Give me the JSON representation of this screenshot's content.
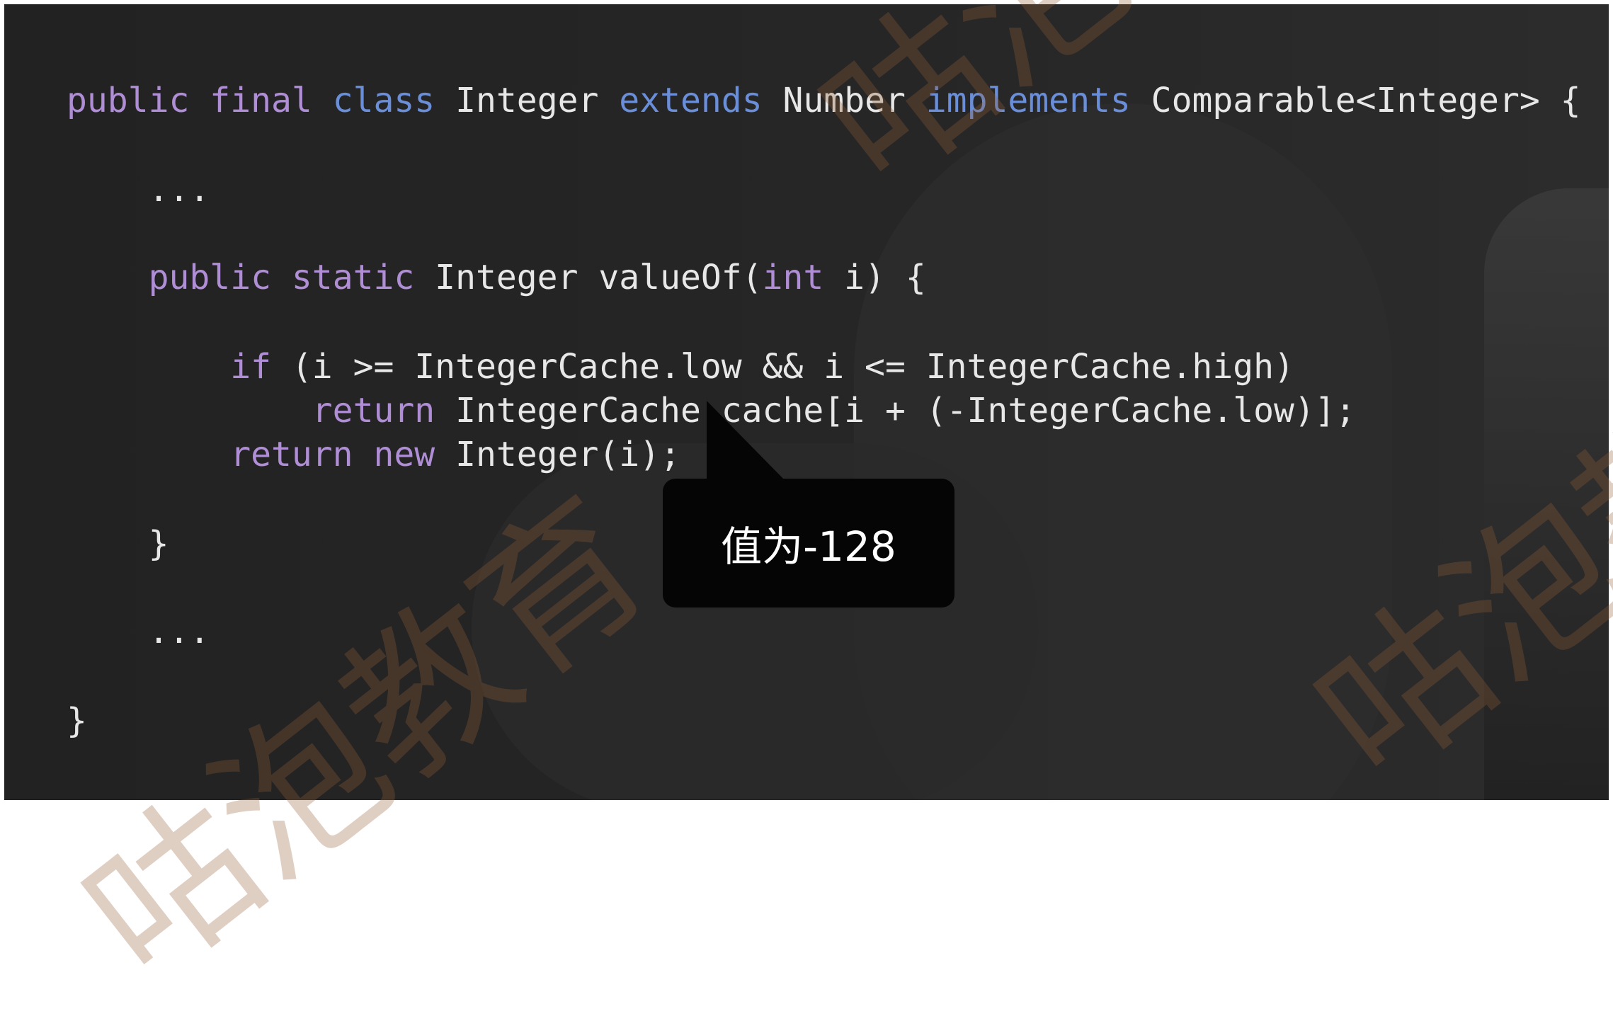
{
  "code": {
    "lines": [
      {
        "tokens": [
          {
            "t": "public",
            "c": "kw"
          },
          {
            "t": " ",
            "c": "plain"
          },
          {
            "t": "final",
            "c": "kw"
          },
          {
            "t": " ",
            "c": "plain"
          },
          {
            "t": "class",
            "c": "kw2"
          },
          {
            "t": " Integer ",
            "c": "plain"
          },
          {
            "t": "extends",
            "c": "kw2"
          },
          {
            "t": " Number ",
            "c": "plain"
          },
          {
            "t": "implements",
            "c": "kw2"
          },
          {
            "t": " Comparable<Integer> {",
            "c": "plain"
          }
        ]
      },
      {
        "tokens": [
          {
            "t": "    ...",
            "c": "plain"
          }
        ]
      },
      {
        "tokens": [
          {
            "t": "    ",
            "c": "plain"
          },
          {
            "t": "public",
            "c": "kw"
          },
          {
            "t": " ",
            "c": "plain"
          },
          {
            "t": "static",
            "c": "kw"
          },
          {
            "t": " Integer valueOf(",
            "c": "plain"
          },
          {
            "t": "int",
            "c": "kw"
          },
          {
            "t": " i) {",
            "c": "plain"
          }
        ]
      },
      {
        "tokens": [
          {
            "t": "        ",
            "c": "plain"
          },
          {
            "t": "if",
            "c": "kw"
          },
          {
            "t": " (i >= IntegerCache.low && i <= IntegerCache.high)",
            "c": "plain"
          }
        ]
      },
      {
        "tokens": [
          {
            "t": "            ",
            "c": "plain"
          },
          {
            "t": "return",
            "c": "kw"
          },
          {
            "t": " IntegerCache.cache[i + (-IntegerCache.low)];",
            "c": "plain"
          }
        ]
      },
      {
        "tokens": [
          {
            "t": "        ",
            "c": "plain"
          },
          {
            "t": "return",
            "c": "kw"
          },
          {
            "t": " ",
            "c": "plain"
          },
          {
            "t": "new",
            "c": "kw"
          },
          {
            "t": " Integer(i);",
            "c": "plain"
          }
        ]
      },
      {
        "tokens": [
          {
            "t": "    }",
            "c": "plain"
          }
        ]
      },
      {
        "tokens": [
          {
            "t": "    ...",
            "c": "plain"
          }
        ]
      },
      {
        "tokens": [
          {
            "t": "}",
            "c": "plain"
          }
        ]
      }
    ]
  },
  "tooltip": {
    "text": "值为-128"
  },
  "watermark": {
    "text": "咕泡教育"
  },
  "colors": {
    "keyword_purple": "#b08ed6",
    "keyword_blue": "#6b8ed8",
    "code_text": "#e7e7e7",
    "background": "#252525",
    "tooltip_bg": "#050505"
  }
}
